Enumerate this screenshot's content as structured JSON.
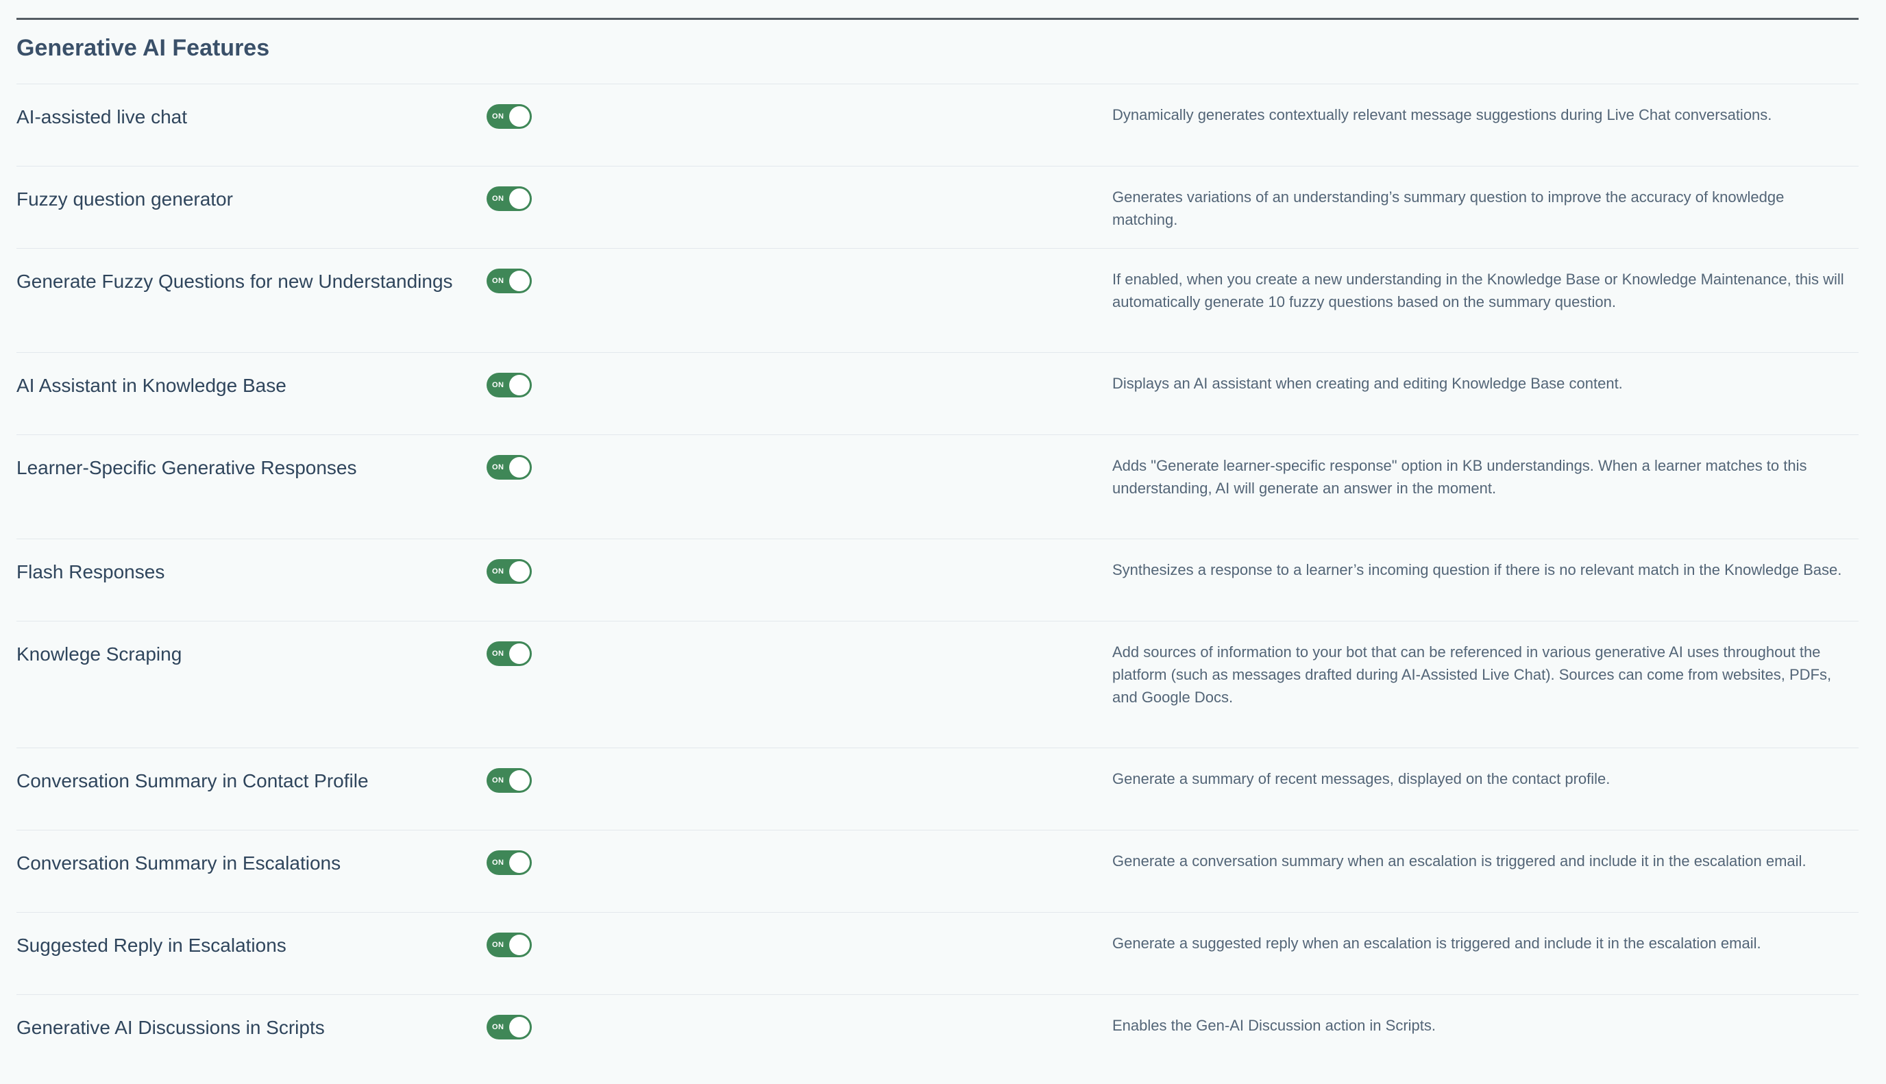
{
  "section": {
    "title": "Generative AI Features"
  },
  "features": [
    {
      "label": "AI-assisted live chat",
      "toggle": "ON",
      "description": "Dynamically generates contextually relevant message suggestions during Live Chat conversations."
    },
    {
      "label": "Fuzzy question generator",
      "toggle": "ON",
      "description": "Generates variations of an understanding’s summary question to improve the accuracy of knowledge matching."
    },
    {
      "label": "Generate Fuzzy Questions for new Understandings",
      "toggle": "ON",
      "description": "If enabled, when you create a new understanding in the Knowledge Base or Knowledge Maintenance, this will automatically generate 10 fuzzy questions based on the summary question."
    },
    {
      "label": "AI Assistant in Knowledge Base",
      "toggle": "ON",
      "description": "Displays an AI assistant when creating and editing Knowledge Base content."
    },
    {
      "label": "Learner-Specific Generative Responses",
      "toggle": "ON",
      "description": "Adds \"Generate learner-specific response\" option in KB understandings. When a learner matches to this understanding, AI will generate an answer in the moment."
    },
    {
      "label": "Flash Responses",
      "toggle": "ON",
      "description": "Synthesizes a response to a learner’s incoming question if there is no relevant match in the Knowledge Base."
    },
    {
      "label": "Knowlege Scraping",
      "toggle": "ON",
      "description": "Add sources of information to your bot that can be referenced in various generative AI uses throughout the platform (such as messages drafted during AI-Assisted Live Chat). Sources can come from websites, PDFs, and Google Docs."
    },
    {
      "label": "Conversation Summary in Contact Profile",
      "toggle": "ON",
      "description": "Generate a summary of recent messages, displayed on the contact profile."
    },
    {
      "label": "Conversation Summary in Escalations",
      "toggle": "ON",
      "description": "Generate a conversation summary when an escalation is triggered and include it in the escalation email."
    },
    {
      "label": "Suggested Reply in Escalations",
      "toggle": "ON",
      "description": "Generate a suggested reply when an escalation is triggered and include it in the escalation email."
    },
    {
      "label": "Generative AI Discussions in Scripts",
      "toggle": "ON",
      "description": "Enables the Gen-AI Discussion action in Scripts."
    }
  ],
  "colors": {
    "toggle_on": "#3f8757",
    "title": "#3a5069",
    "label": "#2f455c",
    "description": "#536577",
    "background": "#f7fafa"
  }
}
